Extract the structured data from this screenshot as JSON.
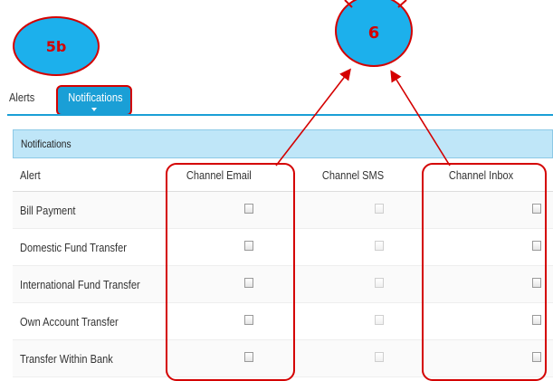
{
  "callouts": {
    "step_a": "5b",
    "step_b": "6"
  },
  "tabs": [
    {
      "label": "Alerts"
    },
    {
      "label": "Notifications"
    }
  ],
  "panel": {
    "title": "Notifications",
    "columns": [
      "Alert",
      "Channel Email",
      "Channel SMS",
      "Channel Inbox"
    ],
    "rows": [
      {
        "alert": "Bill Payment"
      },
      {
        "alert": "Domestic Fund Transfer"
      },
      {
        "alert": "International Fund Transfer"
      },
      {
        "alert": "Own Account Transfer"
      },
      {
        "alert": "Transfer Within Bank"
      }
    ]
  },
  "colors": {
    "accent": "#1a9fd6",
    "callout": "#1cb0ec",
    "highlight": "#d40000",
    "header_bg": "#bfe6f8"
  }
}
